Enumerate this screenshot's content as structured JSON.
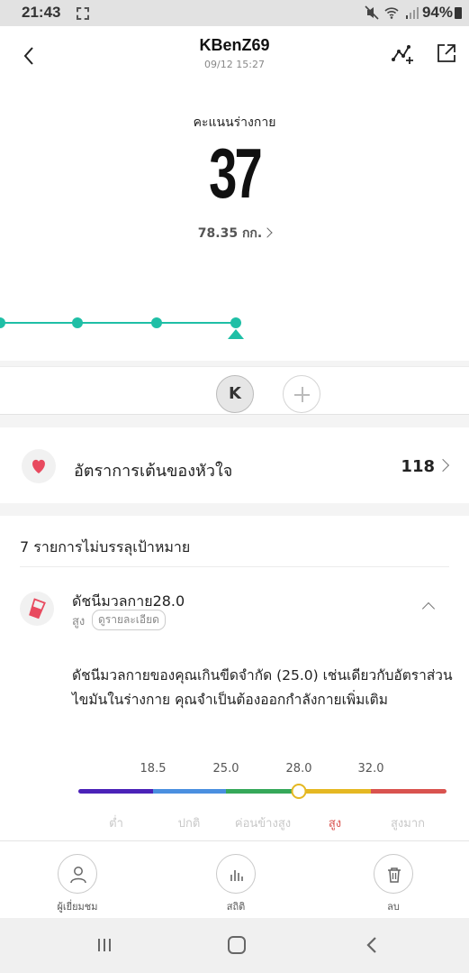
{
  "status_bar": {
    "time": "21:43",
    "battery": "94%"
  },
  "header": {
    "title": "KBenZ69",
    "datetime": "09/12 15:27",
    "score_label": "คะแนนร่างกาย",
    "score_value": "37",
    "weight": "78.35 กก."
  },
  "users": {
    "current_initial": "K"
  },
  "heart_rate": {
    "label": "อัตราการเต้นของหัวใจ",
    "value": "118"
  },
  "targets": {
    "title": "7 รายการไม่บรรลุเป้าหมาย",
    "bmi": {
      "title": "ดัชนีมวลกาย28.0",
      "status": "สูง",
      "detail_label": "ดูรายละเอียด",
      "description": "ดัชนีมวลกายของคุณเกินขีดจำกัด (25.0) เช่นเดียวกับอัตราส่วนไขมันในร่างกาย คุณจำเป็นต้องออกกำลังกายเพิ่มเติม",
      "scale": {
        "ticks": [
          "18.5",
          "25.0",
          "28.0",
          "32.0"
        ],
        "ranges": [
          "ต่ำ",
          "ปกติ",
          "ค่อนข้างสูง",
          "สูง",
          "สูงมาก"
        ],
        "segment_colors": [
          "#4b22b8",
          "#4a8fe0",
          "#36a85a",
          "#e5b822",
          "#d9534f"
        ],
        "current_value": 28.0,
        "current_range_color": "#d9534f",
        "inactive_range_color": "#c8c8c8"
      }
    }
  },
  "bottom_nav": {
    "visitors": "ผู้เยี่ยมชม",
    "stats": "สถิติ",
    "delete": "ลบ"
  },
  "colors": {
    "accent": "#1fbfa6",
    "heart": "#e84a5f"
  }
}
